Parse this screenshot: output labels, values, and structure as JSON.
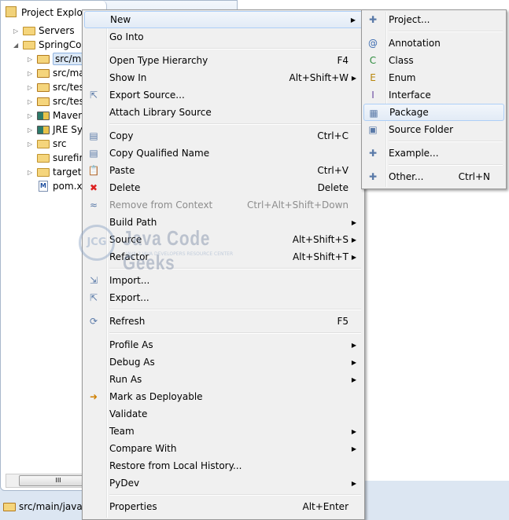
{
  "explorer": {
    "tab_title": "Project Explore",
    "tree": [
      {
        "label": "Servers",
        "level": 0,
        "twisty": "collapsed",
        "icon": "folder"
      },
      {
        "label": "SpringCor",
        "level": 0,
        "twisty": "expanded",
        "icon": "maven-project"
      },
      {
        "label": "src/ma",
        "level": 1,
        "twisty": "collapsed",
        "icon": "package-folder",
        "selected": true
      },
      {
        "label": "src/ma",
        "level": 1,
        "twisty": "collapsed",
        "icon": "package-folder"
      },
      {
        "label": "src/tes",
        "level": 1,
        "twisty": "collapsed",
        "icon": "package-folder"
      },
      {
        "label": "src/tes",
        "level": 1,
        "twisty": "collapsed",
        "icon": "package-folder"
      },
      {
        "label": "Maven",
        "level": 1,
        "twisty": "collapsed",
        "icon": "library"
      },
      {
        "label": "JRE Sy",
        "level": 1,
        "twisty": "collapsed",
        "icon": "library"
      },
      {
        "label": "src",
        "level": 1,
        "twisty": "collapsed",
        "icon": "folder"
      },
      {
        "label": "surefir",
        "level": 1,
        "twisty": "none",
        "icon": "folder"
      },
      {
        "label": "target",
        "level": 1,
        "twisty": "collapsed",
        "icon": "folder"
      },
      {
        "label": "pom.x",
        "level": 1,
        "twisty": "none",
        "icon": "maven-file"
      }
    ],
    "scroll_thumb": "III"
  },
  "status": {
    "text": "src/main/java -"
  },
  "context_menu": [
    {
      "label": "New",
      "submenu": true,
      "highlighted": true
    },
    {
      "label": "Go Into"
    },
    {
      "sep": true
    },
    {
      "label": "Open Type Hierarchy",
      "shortcut": "F4"
    },
    {
      "label": "Show In",
      "shortcut": "Alt+Shift+W",
      "submenu": true
    },
    {
      "label": "Export Source...",
      "icon": "export-source"
    },
    {
      "label": "Attach Library Source"
    },
    {
      "sep": true
    },
    {
      "label": "Copy",
      "shortcut": "Ctrl+C",
      "icon": "copy"
    },
    {
      "label": "Copy Qualified Name",
      "icon": "copy-qualified"
    },
    {
      "label": "Paste",
      "shortcut": "Ctrl+V",
      "icon": "paste"
    },
    {
      "label": "Delete",
      "shortcut": "Delete",
      "icon": "delete"
    },
    {
      "label": "Remove from Context",
      "shortcut": "Ctrl+Alt+Shift+Down",
      "disabled": true,
      "icon": "remove-context"
    },
    {
      "label": "Build Path",
      "submenu": true
    },
    {
      "label": "Source",
      "shortcut": "Alt+Shift+S",
      "submenu": true
    },
    {
      "label": "Refactor",
      "shortcut": "Alt+Shift+T",
      "submenu": true
    },
    {
      "sep": true
    },
    {
      "label": "Import...",
      "icon": "import"
    },
    {
      "label": "Export...",
      "icon": "export"
    },
    {
      "sep": true
    },
    {
      "label": "Refresh",
      "shortcut": "F5",
      "icon": "refresh"
    },
    {
      "sep": true
    },
    {
      "label": "Profile As",
      "submenu": true
    },
    {
      "label": "Debug As",
      "submenu": true
    },
    {
      "label": "Run As",
      "submenu": true
    },
    {
      "label": "Mark as Deployable",
      "icon": "deployable"
    },
    {
      "label": "Validate"
    },
    {
      "label": "Team",
      "submenu": true
    },
    {
      "label": "Compare With",
      "submenu": true
    },
    {
      "label": "Restore from Local History..."
    },
    {
      "label": "PyDev",
      "submenu": true
    },
    {
      "sep": true
    },
    {
      "label": "Properties",
      "shortcut": "Alt+Enter"
    }
  ],
  "new_submenu": [
    {
      "label": "Project...",
      "icon": "new-project"
    },
    {
      "sep": true
    },
    {
      "label": "Annotation",
      "icon": "annotation"
    },
    {
      "label": "Class",
      "icon": "class"
    },
    {
      "label": "Enum",
      "icon": "enum"
    },
    {
      "label": "Interface",
      "icon": "interface"
    },
    {
      "label": "Package",
      "icon": "package",
      "highlighted": true
    },
    {
      "label": "Source Folder",
      "icon": "source-folder"
    },
    {
      "sep": true
    },
    {
      "label": "Example...",
      "icon": "example"
    },
    {
      "sep": true
    },
    {
      "label": "Other...",
      "shortcut": "Ctrl+N",
      "icon": "other"
    }
  ],
  "watermark": {
    "logo": "JCG",
    "title": "Java Code Geeks",
    "tagline": "JAVA 2 JAVA DEVELOPERS RESOURCE CENTER"
  }
}
